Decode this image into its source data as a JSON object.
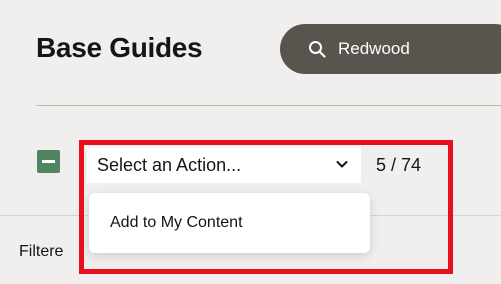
{
  "header": {
    "title": "Base Guides"
  },
  "search": {
    "value": "Redwood",
    "icon": "search-icon"
  },
  "toolbar": {
    "collapse_icon": "minus-icon",
    "action_select": {
      "value": "Select an Action...",
      "icon": "chevron-down-icon"
    },
    "count": "5 / 74"
  },
  "dropdown": {
    "items": [
      {
        "label": "Add to My Content"
      }
    ]
  },
  "list": {
    "filtered_label": "Filtere"
  },
  "colors": {
    "background": "#f1efed",
    "search_pill": "#5a544e",
    "collapse_button": "#508561",
    "highlight": "#e8101e"
  }
}
